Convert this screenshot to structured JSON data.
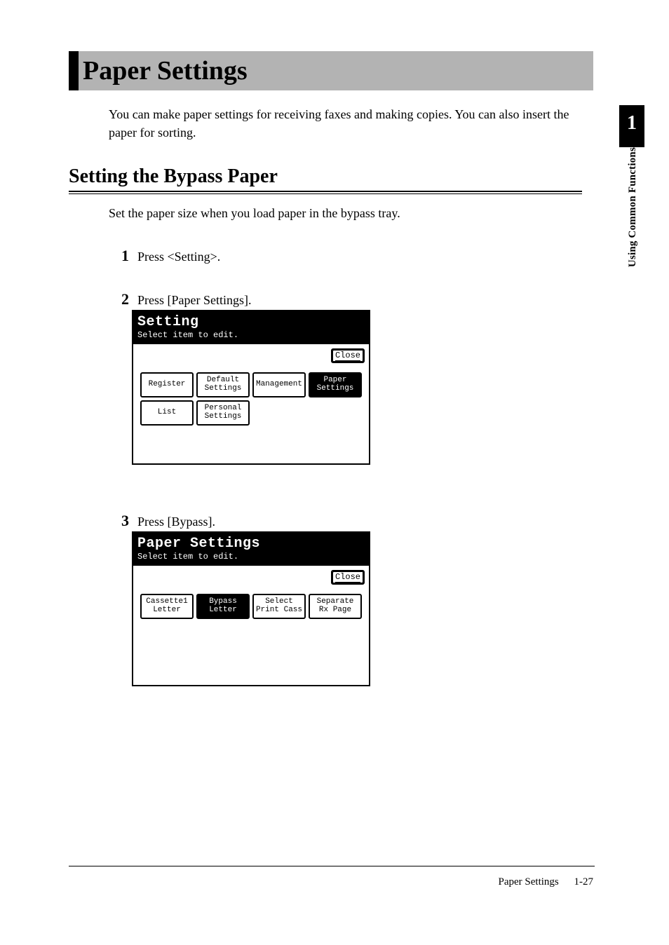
{
  "title": "Paper Settings",
  "intro": "You can make paper settings for receiving faxes and making copies. You can also insert the paper for sorting.",
  "side": {
    "chapter_number": "1",
    "label": "Using Common Functions"
  },
  "section": {
    "heading": "Setting the Bypass Paper",
    "intro": "Set the paper size when you load paper in the bypass tray."
  },
  "steps": {
    "s1": {
      "num": "1",
      "text": "Press <Setting>."
    },
    "s2": {
      "num": "2",
      "text": "Press [Paper Settings]."
    },
    "s3": {
      "num": "3",
      "text": "Press [Bypass]."
    }
  },
  "screen1": {
    "title": "Setting",
    "subtitle": "Select item to edit.",
    "close": "Close",
    "buttons": {
      "register": "Register",
      "default_l1": "Default",
      "default_l2": "Settings",
      "management": "Management",
      "paper_l1": "Paper",
      "paper_l2": "Settings",
      "list": "List",
      "personal_l1": "Personal",
      "personal_l2": "Settings"
    }
  },
  "screen2": {
    "title": "Paper Settings",
    "subtitle": "Select item to edit.",
    "close": "Close",
    "buttons": {
      "cassette1_l1": "Cassette1",
      "cassette1_l2": "Letter",
      "bypass_l1": "Bypass",
      "bypass_l2": "Letter",
      "select_l1": "Select",
      "select_l2": "Print Cass",
      "separate_l1": "Separate",
      "separate_l2": "Rx Page"
    }
  },
  "footer": {
    "label": "Paper Settings",
    "page": "1-27"
  }
}
